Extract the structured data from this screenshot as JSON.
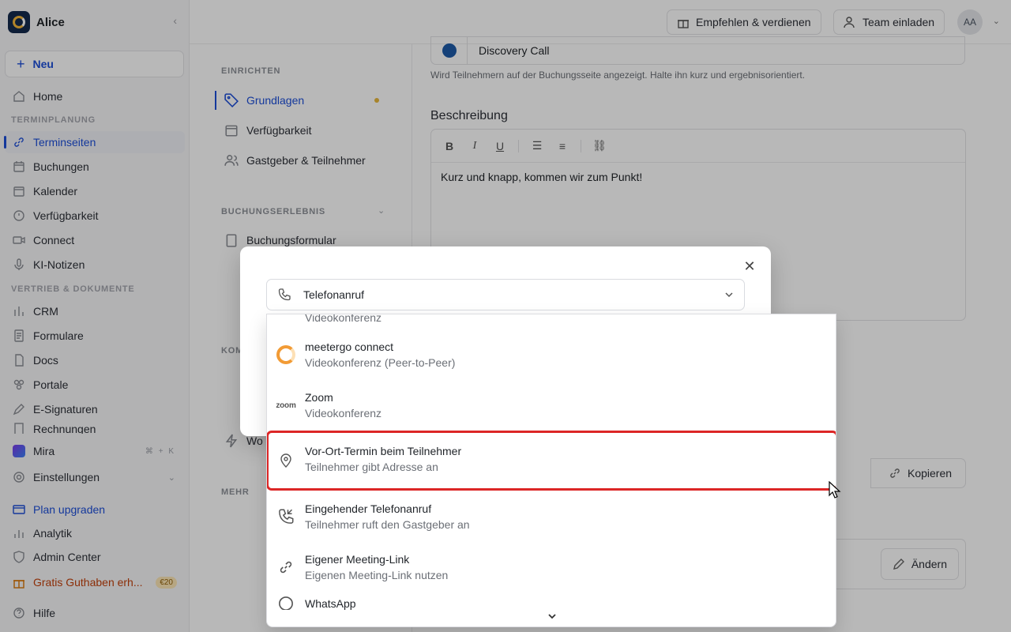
{
  "sidebar": {
    "workspace": "Alice",
    "new_label": "Neu",
    "home": "Home",
    "sections": {
      "scheduling": "TERMINPLANUNG",
      "sales": "VERTRIEB & DOKUMENTE"
    },
    "scheduling_items": [
      "Terminseiten",
      "Buchungen",
      "Kalender",
      "Verfügbarkeit",
      "Connect",
      "KI-Notizen"
    ],
    "sales_items": [
      "CRM",
      "Formulare",
      "Docs",
      "Portale",
      "E-Signaturen",
      "Rechnungen"
    ],
    "mira": "Mira",
    "mira_shortcut": "⌘ + K",
    "settings": "Einstellungen",
    "plan_upgrade": "Plan upgraden",
    "analytics": "Analytik",
    "admin": "Admin Center",
    "gift": "Gratis Guthaben erh...",
    "gift_badge": "€20",
    "help": "Hilfe"
  },
  "topbar": {
    "refer": "Empfehlen & verdienen",
    "invite": "Team einladen",
    "avatar": "AA"
  },
  "subnav": {
    "setup_section": "EINRICHTEN",
    "setup_items": [
      "Grundlagen",
      "Verfügbarkeit",
      "Gastgeber & Teilnehmer"
    ],
    "booking_section": "BUCHUNGSERLEBNIS",
    "booking_items": [
      "Buchungsformular"
    ],
    "comm_section": "KOM",
    "workflow_partial": "Wo",
    "more_section": "MEHR"
  },
  "main": {
    "name_value": "Discovery Call",
    "name_hint": "Wird Teilnehmern auf der Buchungsseite angezeigt. Halte ihn kurz und ergebnisorientiert.",
    "description_label": "Beschreibung",
    "description_text": "Kurz und knapp, kommen wir zum Punkt!",
    "copy_label": "Kopieren",
    "change_label": "Ändern"
  },
  "modal": {
    "selected": "Telefonanruf"
  },
  "dropdown": {
    "partial_top": "Videokonferenz",
    "options": [
      {
        "title": "meetergo connect",
        "subtitle": "Videokonferenz (Peer-to-Peer)",
        "icon": "meetergo-icon"
      },
      {
        "title": "Zoom",
        "subtitle": "Videokonferenz",
        "icon": "zoom-icon",
        "icon_text": "zoom"
      },
      {
        "title": "Vor-Ort-Termin beim Teilnehmer",
        "subtitle": "Teilnehmer gibt Adresse an",
        "icon": "location-pin-icon"
      },
      {
        "title": "Eingehender Telefonanruf",
        "subtitle": "Teilnehmer ruft den Gastgeber an",
        "icon": "phone-incoming-icon"
      },
      {
        "title": "Eigener Meeting-Link",
        "subtitle": "Eigenen Meeting-Link nutzen",
        "icon": "link-icon"
      },
      {
        "title": "WhatsApp",
        "subtitle": "",
        "icon": "whatsapp-icon"
      }
    ],
    "highlight_color": "#dc2626"
  }
}
